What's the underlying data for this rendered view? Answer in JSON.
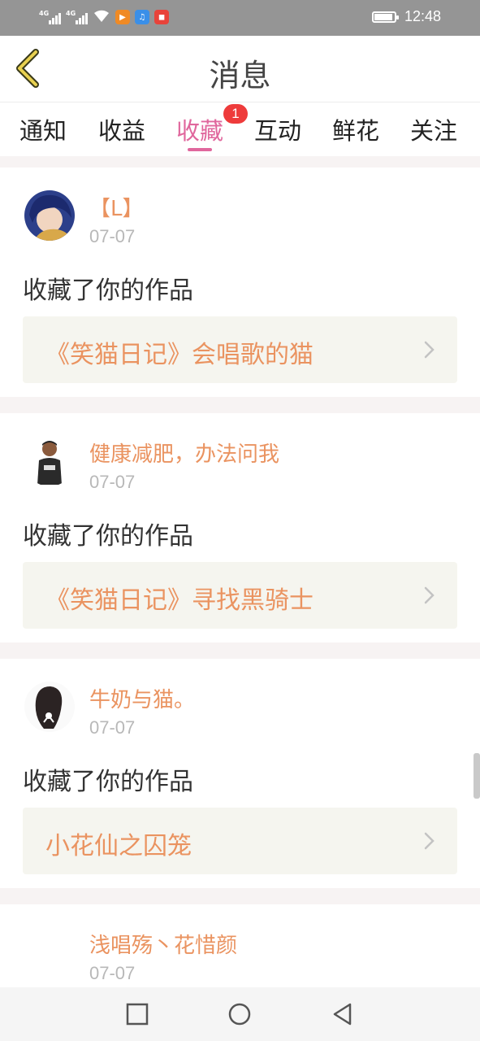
{
  "status_bar": {
    "network_1": "4G",
    "network_2": "4G",
    "time": "12:48",
    "icons": [
      "signal-icon",
      "signal-icon",
      "wifi-icon",
      "video-app-icon",
      "music-app-icon",
      "shop-app-icon",
      "battery-icon"
    ]
  },
  "header": {
    "title": "消息",
    "back_icon": "chevron-left-icon",
    "accent_color": "#e8d050"
  },
  "tabs": {
    "items": [
      {
        "label": "通知"
      },
      {
        "label": "收益"
      },
      {
        "label": "收藏",
        "active": true,
        "badge": "1"
      },
      {
        "label": "互动"
      },
      {
        "label": "鲜花"
      },
      {
        "label": "关注"
      }
    ],
    "active_color": "#e0679d"
  },
  "messages": [
    {
      "user": "【L】",
      "date": "07-07",
      "action": "收藏了你的作品",
      "work": "《笑猫日记》会唱歌的猫"
    },
    {
      "user": "健康减肥，办法问我",
      "date": "07-07",
      "action": "收藏了你的作品",
      "work": "《笑猫日记》寻找黑骑士"
    },
    {
      "user": "牛奶与猫。",
      "date": "07-07",
      "action": "收藏了你的作品",
      "work": "小花仙之囚笼"
    },
    {
      "user": "浅唱殇丶花惜颜",
      "date": "07-07"
    }
  ],
  "colors": {
    "name_color": "#ea9360",
    "badge_color": "#ee3b3b",
    "status_bar_bg": "#959595"
  },
  "nav_bar": {
    "icons": [
      "square-recents-icon",
      "circle-home-icon",
      "triangle-back-icon"
    ]
  }
}
